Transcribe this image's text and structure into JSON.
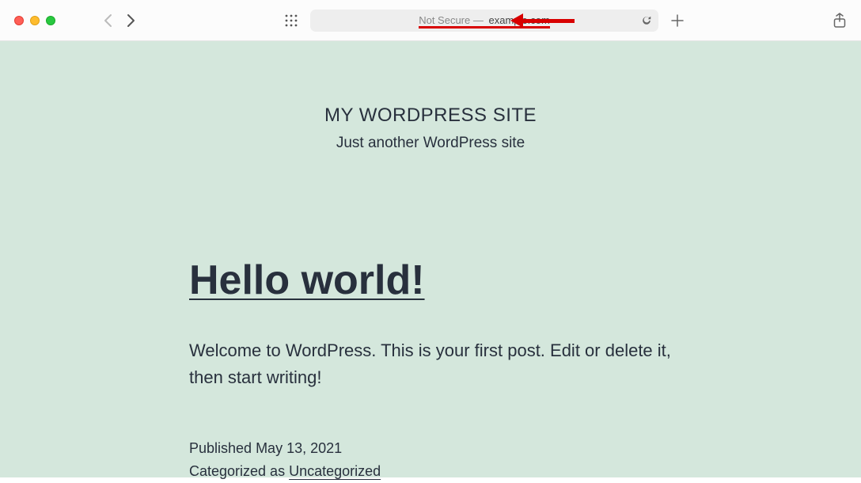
{
  "browser": {
    "address_prefix": "Not Secure —",
    "address_domain": "example.com"
  },
  "site": {
    "title": "MY WORDPRESS SITE",
    "tagline": "Just another WordPress site"
  },
  "post": {
    "title": "Hello world!",
    "body": "Welcome to WordPress. This is your first post. Edit or delete it, then start writing!",
    "published_label": "Published ",
    "published_date": "May 13, 2021",
    "categorized_label": "Categorized as ",
    "category": "Uncategorized"
  }
}
